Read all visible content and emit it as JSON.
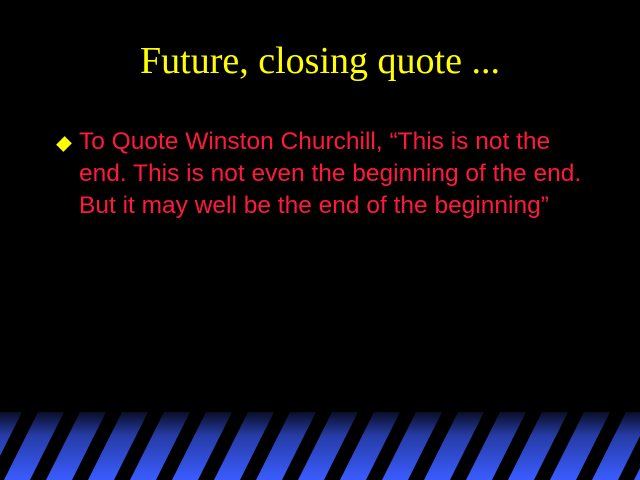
{
  "slide": {
    "title": "Future, closing quote ...",
    "bullets": [
      {
        "text": "To Quote Winston Churchill, “This is not the end. This is not even the beginning of the end. But it may well be the end of the beginning”"
      }
    ]
  },
  "colors": {
    "background": "#000000",
    "title": "#ffff00",
    "bullet_marker": "#ffff00",
    "body_text": "#ff1a3a",
    "stripe_light": "#3a5cff",
    "stripe_dark": "#000000"
  },
  "icons": {
    "bullet": "diamond-bullet-icon"
  }
}
